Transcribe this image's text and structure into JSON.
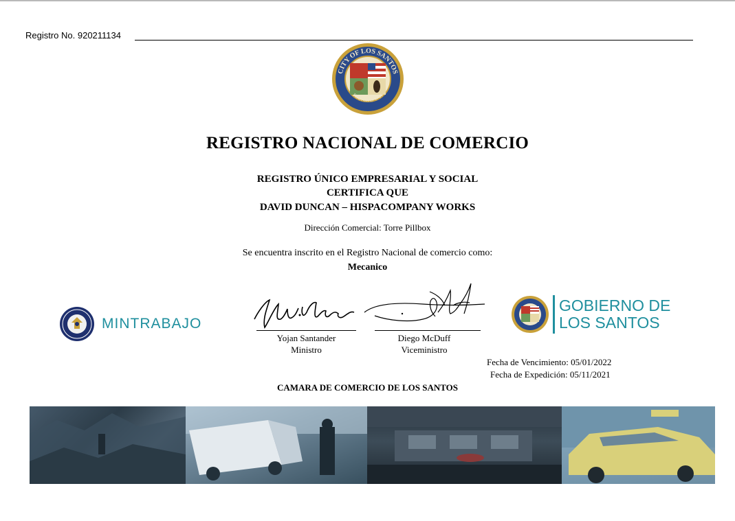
{
  "registro": {
    "label": "Registro No. 920211134"
  },
  "seal": {
    "text": "CITY OF LOS SANTOS",
    "subtext": "FOUNDED 1781"
  },
  "title": "REGISTRO NACIONAL DE COMERCIO",
  "subtitle1": "REGISTRO ÚNICO EMPRESARIAL Y SOCIAL",
  "subtitle2": "CERTIFICA QUE",
  "company": "DAVID DUNCAN – HISPACOMPANY WORKS",
  "address": "Dirección Comercial: Torre Pillbox",
  "intro": "Se encuentra inscrito en el Registro Nacional de comercio como:",
  "activity": "Mecanico",
  "logos": {
    "mintrabajo": "MINTRABAJO",
    "gobierno_line1": "GOBIERNO DE",
    "gobierno_line2": "LOS SANTOS"
  },
  "signatures": [
    {
      "name": "Yojan Santander",
      "title": "Ministro"
    },
    {
      "name": "Diego McDuff",
      "title": "Viceministro"
    }
  ],
  "dates": {
    "vencimiento": "Fecha de Vencimiento: 05/01/2022",
    "expedicion": "Fecha de Expedición: 05/11/2021"
  },
  "footer": "CAMARA DE COMERCIO DE LOS SANTOS",
  "colors": {
    "brand_teal": "#1f8f9e",
    "seal_gold": "#c9a13a",
    "seal_blue": "#2a4a8a"
  }
}
